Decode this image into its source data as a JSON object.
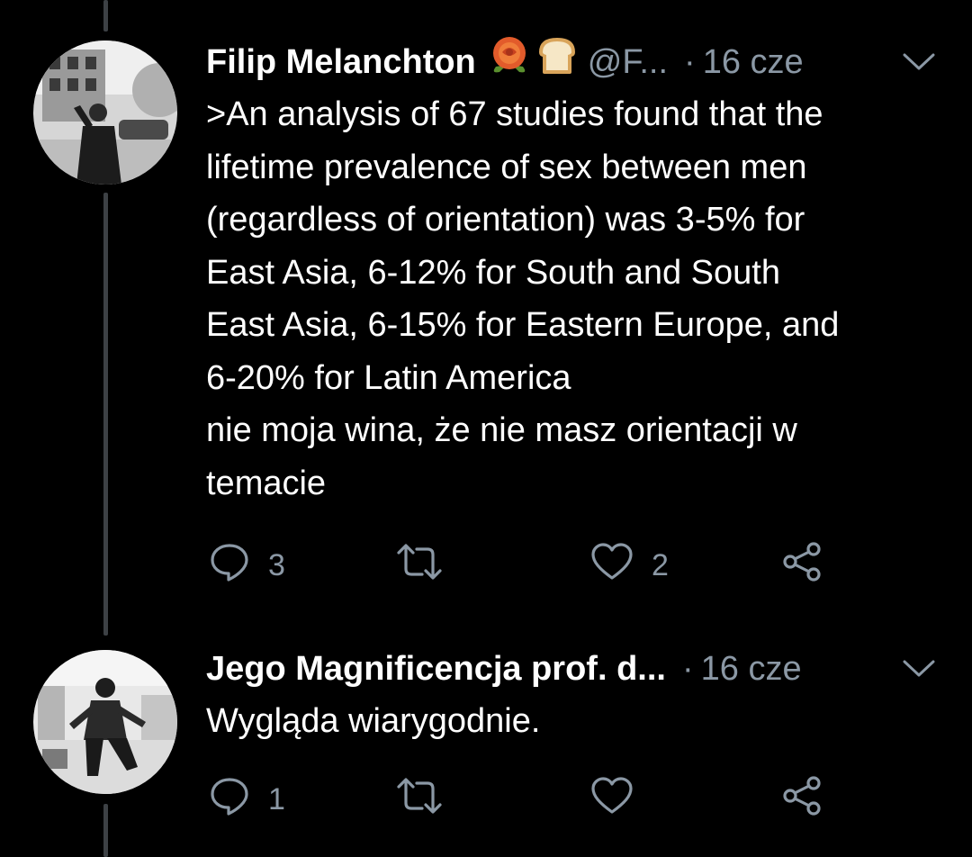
{
  "colors": {
    "background": "#000000",
    "primary_text": "#ffffff",
    "secondary_text": "#8b98a5",
    "thread_line": "#3d4145"
  },
  "tweets": [
    {
      "display_name": "Filip Melanchton",
      "emojis": [
        "rose-emoji",
        "bread-emoji"
      ],
      "handle": "@F...",
      "separator": "·",
      "time": "16 cze",
      "text_lines": [
        ">An analysis of 67 studies found that the",
        "lifetime prevalence of sex between men",
        "(regardless of orientation) was 3-5% for",
        "East Asia, 6-12% for South and South",
        "East Asia, 6-15% for Eastern Europe, and",
        "6-20% for Latin America",
        "nie moja wina, że nie masz orientacji w",
        "temacie"
      ],
      "reply_count": "3",
      "retweet_count": "",
      "like_count": "2"
    },
    {
      "display_name": "Jego Magnificencja prof. d...",
      "separator": "·",
      "time": "16 cze",
      "text_lines": [
        "Wygląda wiarygodnie."
      ],
      "reply_count": "1",
      "retweet_count": "",
      "like_count": ""
    }
  ]
}
